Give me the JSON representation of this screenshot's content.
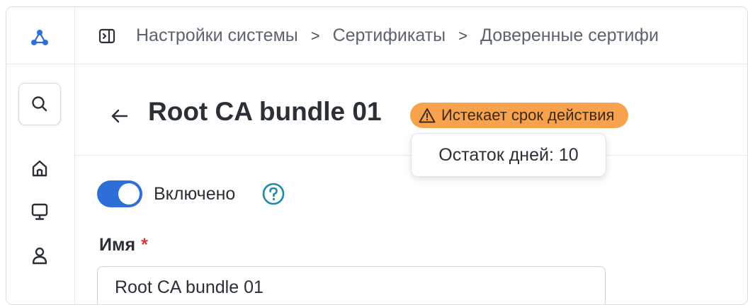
{
  "breadcrumb": {
    "items": [
      "Настройки системы",
      "Сертификаты",
      "Доверенные сертифи"
    ]
  },
  "sidebar": {
    "icons": [
      "logo-icon",
      "search-icon",
      "home-icon",
      "monitor-icon",
      "user-icon"
    ]
  },
  "header": {
    "title": "Root CA bundle 01",
    "badge": "Истекает срок действия",
    "tooltip": "Остаток дней: 10"
  },
  "form": {
    "toggle_label": "Включено",
    "toggle_on": true,
    "name_label": "Имя",
    "name_required_mark": "*",
    "name_value": "Root CA bundle 01"
  },
  "colors": {
    "accent": "#2d6fd6",
    "warning_badge": "#f8a24e",
    "help": "#1f8aa8",
    "required": "#d13b3b"
  }
}
